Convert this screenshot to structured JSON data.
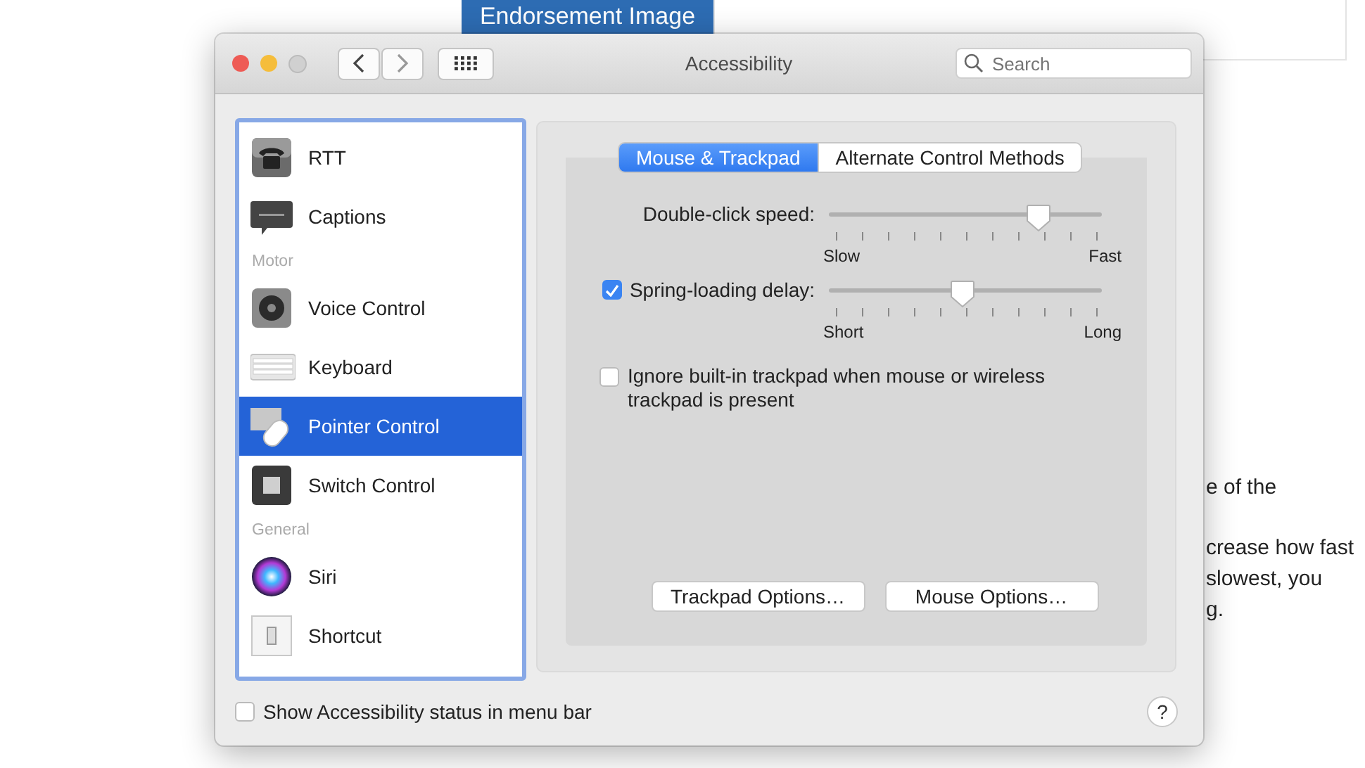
{
  "page": {
    "banner": "Endorsement Image",
    "article_paragraphs": [
      "e of the",
      "crease how fast\nslowest, you\ng."
    ]
  },
  "window": {
    "title": "Accessibility",
    "search": {
      "placeholder": "Search"
    }
  },
  "sidebar": {
    "items": [
      {
        "kind": "item",
        "label": "RTT",
        "selected": false
      },
      {
        "kind": "item",
        "label": "Captions",
        "selected": false
      },
      {
        "kind": "header",
        "label": "Motor"
      },
      {
        "kind": "item",
        "label": "Voice Control",
        "selected": false
      },
      {
        "kind": "item",
        "label": "Keyboard",
        "selected": false
      },
      {
        "kind": "item",
        "label": "Pointer Control",
        "selected": true
      },
      {
        "kind": "item",
        "label": "Switch Control",
        "selected": false
      },
      {
        "kind": "header",
        "label": "General"
      },
      {
        "kind": "item",
        "label": "Siri",
        "selected": false
      },
      {
        "kind": "item",
        "label": "Shortcut",
        "selected": false
      }
    ]
  },
  "tabs": [
    {
      "label": "Mouse & Trackpad",
      "selected": true
    },
    {
      "label": "Alternate Control Methods",
      "selected": false
    }
  ],
  "settings": [
    {
      "kind": "slider",
      "label": "Double-click speed:",
      "level": 0.77,
      "min_label": "Slow",
      "max_label": "Fast"
    },
    {
      "kind": "check-slider",
      "label": "Spring-loading delay:",
      "checked": true,
      "level": 0.49,
      "min_label": "Short",
      "max_label": "Long"
    },
    {
      "kind": "checkbox",
      "label": "Ignore built-in trackpad when mouse or wireless trackpad is present",
      "checked": false
    }
  ],
  "buttons": [
    "Trackpad Options…",
    "Mouse Options…"
  ],
  "footer": {
    "checkbox": {
      "label": "Show Accessibility status in menu bar",
      "checked": false
    },
    "help": "?"
  }
}
